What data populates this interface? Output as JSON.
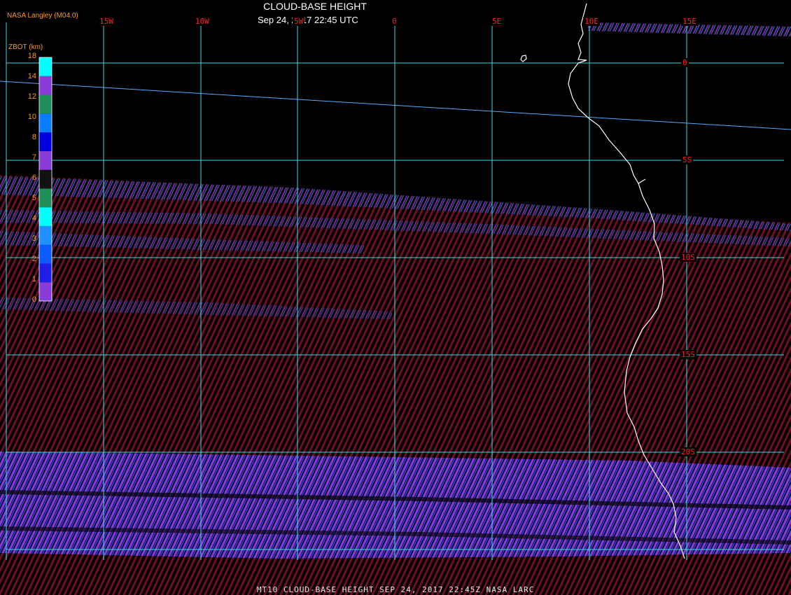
{
  "header": {
    "title": "CLOUD-BASE HEIGHT",
    "subtitle": "Sep 24, 2017 22:45 UTC",
    "credit": "NASA Langley (M04.0)"
  },
  "legend": {
    "title": "ZBOT (km)",
    "ticks": [
      "0",
      "1",
      "2",
      "3",
      "4",
      "5",
      "6",
      "7",
      "8",
      "10",
      "12",
      "14",
      "18"
    ],
    "bins": [
      "#8a3cd8",
      "#1e1ee6",
      "#0a5cff",
      "#1e90ff",
      "#00ffff",
      "#1e8f5a",
      "#111111",
      "#8a3cd8",
      "#0000e0",
      "#0a7cff",
      "#1e8f5a",
      "#8a3cd8",
      "#00ffff"
    ]
  },
  "grid": {
    "longitudes": [
      "15W",
      "10W",
      "5W",
      "0",
      "5E",
      "10E",
      "15E"
    ],
    "latitudes": [
      "0",
      "5S",
      "10S",
      "15S",
      "20S"
    ]
  },
  "colors": {
    "grid": "#40d8e0",
    "labels": "#ff2020",
    "coast": "#ffffff",
    "stripe_low": "#701020",
    "stripe_high": "#8a3cd8"
  },
  "footer": "MT10   CLOUD-BASE HEIGHT   SEP 24, 2017 22:45Z   NASA LARC"
}
